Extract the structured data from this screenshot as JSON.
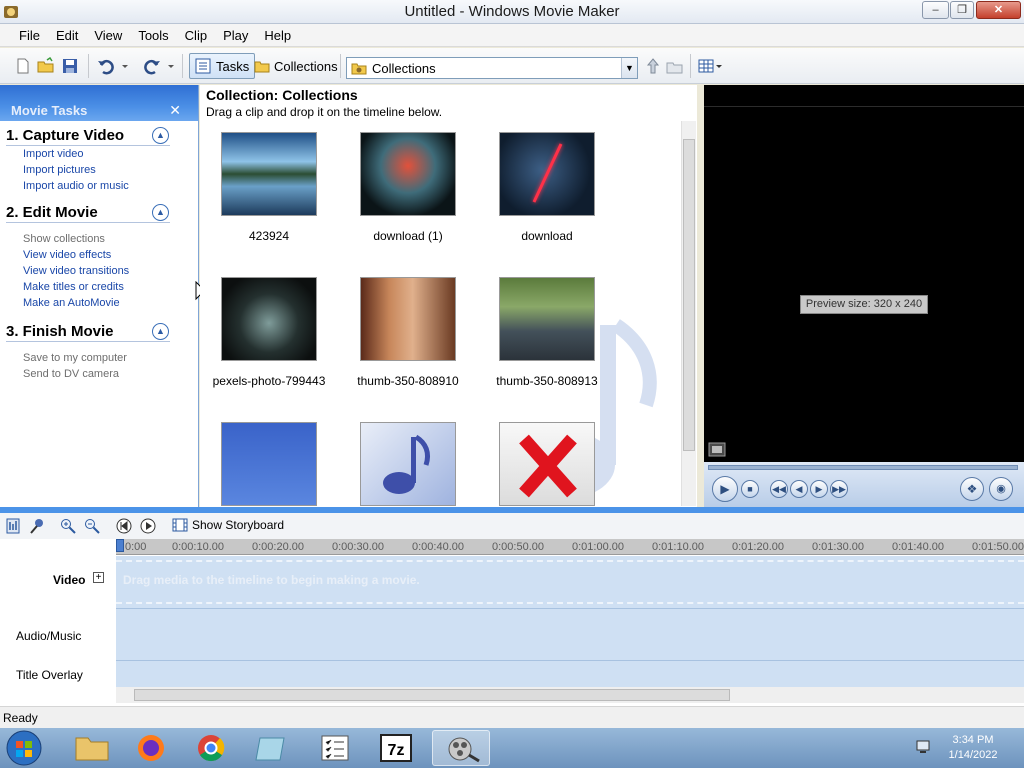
{
  "window": {
    "title": "Untitled - Windows Movie Maker"
  },
  "menu": [
    "File",
    "Edit",
    "View",
    "Tools",
    "Clip",
    "Play",
    "Help"
  ],
  "toolbar": {
    "tasks_label": "Tasks",
    "collections_label": "Collections",
    "combo_value": "Collections"
  },
  "tasks": {
    "header": "Movie Tasks",
    "sections": [
      {
        "title": "1. Capture Video",
        "links": [
          "Import video",
          "Import pictures",
          "Import audio or music"
        ]
      },
      {
        "title": "2. Edit Movie",
        "links": [
          "Show collections",
          "View video effects",
          "View video transitions",
          "Make titles or credits",
          "Make an AutoMovie"
        ]
      },
      {
        "title": "3. Finish Movie",
        "links": [
          "Save to my computer",
          "Send to DV camera"
        ]
      }
    ]
  },
  "collection": {
    "title": "Collection: Collections",
    "subtitle": "Drag a clip and drop it on the timeline below.",
    "items": [
      "423924",
      "download (1)",
      "download",
      "pexels-photo-799443",
      "thumb-350-808910",
      "thumb-350-808913"
    ]
  },
  "preview": {
    "size_label": "Preview size: 320 x 240"
  },
  "timeline": {
    "storyboard_label": "Show Storyboard",
    "ticks": [
      "0:00",
      "0:00:10.00",
      "0:00:20.00",
      "0:00:30.00",
      "0:00:40.00",
      "0:00:50.00",
      "0:01:00.00",
      "0:01:10.00",
      "0:01:20.00",
      "0:01:30.00",
      "0:01:40.00",
      "0:01:50.00"
    ],
    "tracks": [
      "Video",
      "Audio/Music",
      "Title Overlay"
    ],
    "drag_hint": "Drag media to the timeline to begin making a movie."
  },
  "status": "Ready",
  "clock": {
    "time": "3:34 PM",
    "date": "1/14/2022"
  },
  "colors": {
    "accent": "#4b93e8",
    "link": "#1a47a8"
  }
}
